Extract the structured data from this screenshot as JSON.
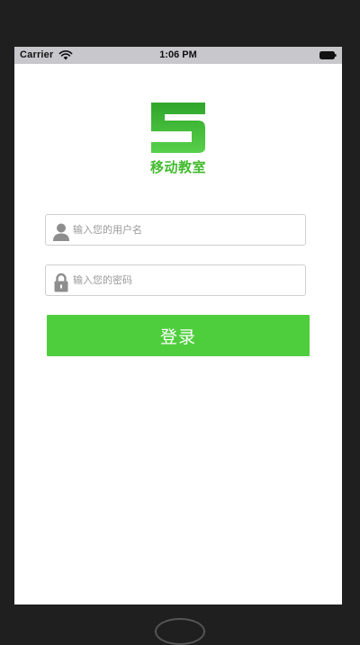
{
  "status_bar": {
    "carrier": "Carrier",
    "time": "1:06 PM",
    "wifi_icon": "wifi-icon",
    "battery_icon": "battery-icon"
  },
  "logo": {
    "glyph": "5",
    "caption": "移动教室",
    "color": "#42bb2e"
  },
  "form": {
    "username": {
      "placeholder": "输入您的用户名",
      "value": "",
      "icon": "user-icon"
    },
    "password": {
      "placeholder": "输入您的密码",
      "value": "",
      "icon": "lock-icon"
    },
    "login_label": "登录",
    "button_color": "#4fce3d"
  }
}
